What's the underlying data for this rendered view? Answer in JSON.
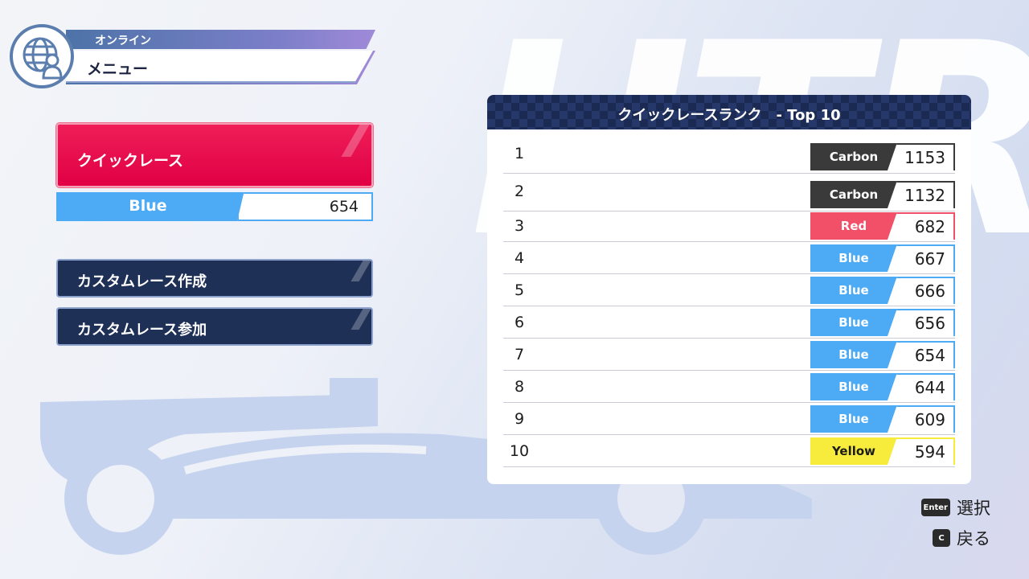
{
  "header": {
    "category": "オンライン",
    "title": "メニュー"
  },
  "menu": {
    "quick_race": "クイックレース",
    "team": {
      "name": "Blue",
      "score": "654",
      "color": "#4daaf4"
    },
    "custom_create": "カスタムレース作成",
    "custom_join": "カスタムレース参加"
  },
  "ranking": {
    "title": "クイックレースランク　- Top 10",
    "rows": [
      {
        "pos": "1",
        "name": "",
        "team": "Carbon",
        "color": "#3a3a3a",
        "text_color": "#ffffff",
        "points": "1153"
      },
      {
        "pos": "2",
        "name": "",
        "team": "Carbon",
        "color": "#3a3a3a",
        "text_color": "#ffffff",
        "points": "1132"
      },
      {
        "pos": "3",
        "name": "",
        "team": "Red",
        "color": "#f25068",
        "text_color": "#ffffff",
        "points": "682"
      },
      {
        "pos": "4",
        "name": "",
        "team": "Blue",
        "color": "#4daaf4",
        "text_color": "#ffffff",
        "points": "667"
      },
      {
        "pos": "5",
        "name": "",
        "team": "Blue",
        "color": "#4daaf4",
        "text_color": "#ffffff",
        "points": "666"
      },
      {
        "pos": "6",
        "name": "",
        "team": "Blue",
        "color": "#4daaf4",
        "text_color": "#ffffff",
        "points": "656"
      },
      {
        "pos": "7",
        "name": "",
        "team": "Blue",
        "color": "#4daaf4",
        "text_color": "#ffffff",
        "points": "654"
      },
      {
        "pos": "8",
        "name": "",
        "team": "Blue",
        "color": "#4daaf4",
        "text_color": "#ffffff",
        "points": "644"
      },
      {
        "pos": "9",
        "name": "",
        "team": "Blue",
        "color": "#4daaf4",
        "text_color": "#ffffff",
        "points": "609"
      },
      {
        "pos": "10",
        "name": "",
        "team": "Yellow",
        "color": "#f7ec3c",
        "text_color": "#1c1c1c",
        "points": "594"
      }
    ]
  },
  "controls": {
    "select_key": "Enter",
    "select_label": "選択",
    "back_key": "C",
    "back_label": "戻る"
  }
}
